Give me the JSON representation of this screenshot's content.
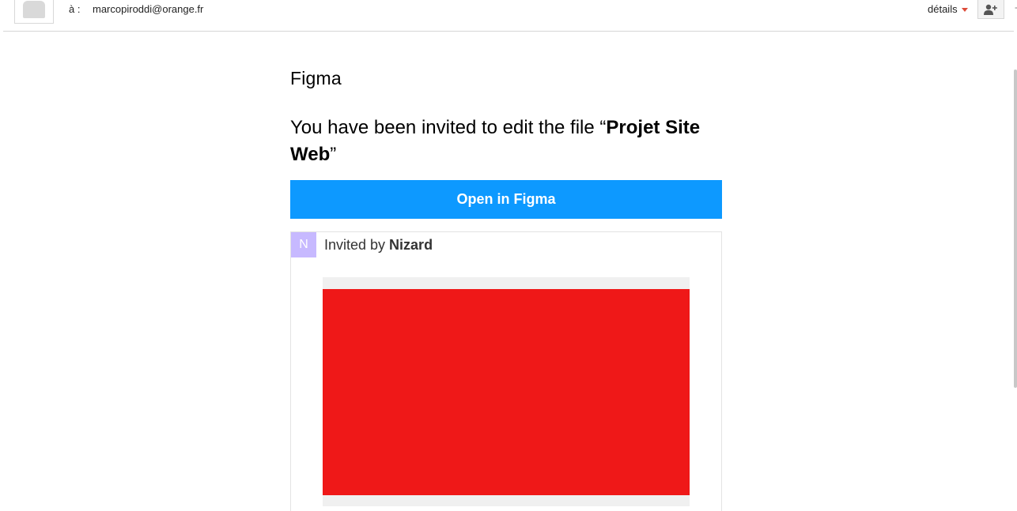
{
  "header": {
    "to_label": "à :",
    "to_address": "marcopiroddi@orange.fr",
    "details_label": "détails",
    "add_contact_icon": "add-person-icon"
  },
  "email": {
    "logo": "Figma",
    "headline_prefix": "You have been invited to edit the file “",
    "file_name": "Projet Site Web",
    "headline_suffix": "”",
    "cta_label": "Open in Figma",
    "inviter_initial": "N",
    "invited_by_prefix": "Invited by ",
    "inviter_name": "Nizard"
  },
  "colors": {
    "cta_background": "#0d99ff",
    "inviter_avatar": "#c7b9ff",
    "thumbnail": "#ef1818",
    "caret": "#dd4b39"
  }
}
